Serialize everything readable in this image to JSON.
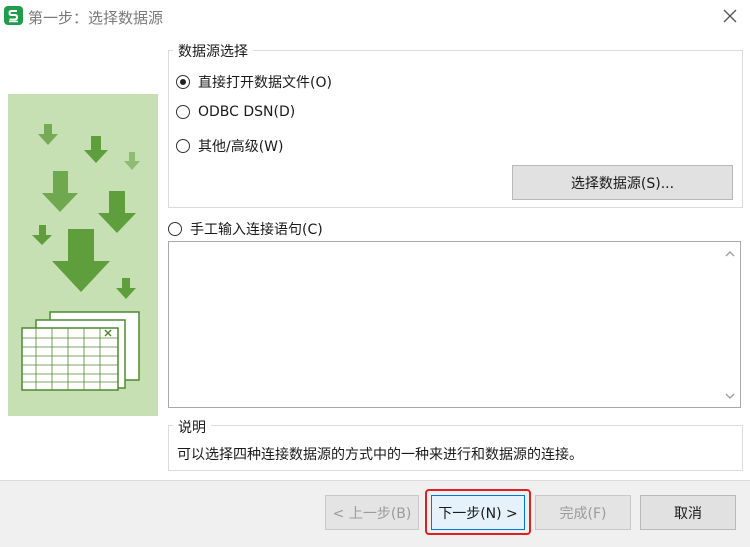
{
  "window": {
    "title": "第一步：选择数据源",
    "app_icon_letter": "S",
    "app_icon_color": "#1e9e4a",
    "close_icon": "close-icon"
  },
  "side_art": {
    "background_color": "#c7e0b3",
    "arrow_color": "#5f9e3c",
    "icon": "download-spreadsheet-illustration"
  },
  "data_source_group": {
    "legend": "数据源选择",
    "options": [
      {
        "label": "直接打开数据文件(O)",
        "checked": true
      },
      {
        "label": "ODBC DSN(D)",
        "checked": false
      },
      {
        "label": "其他/高级(W)",
        "checked": false
      }
    ],
    "choose_button": "选择数据源(S)..."
  },
  "manual": {
    "label": "手工输入连接语句(C)",
    "checked": false,
    "value": ""
  },
  "description": {
    "legend": "说明",
    "text": "可以选择四种连接数据源的方式中的一种来进行和数据源的连接。"
  },
  "footer": {
    "prev_label": "< 上一步(B)",
    "next_label": "下一步(N) >",
    "finish_label": "完成(F)",
    "cancel_label": "取消",
    "highlight_color": "#e02020"
  }
}
